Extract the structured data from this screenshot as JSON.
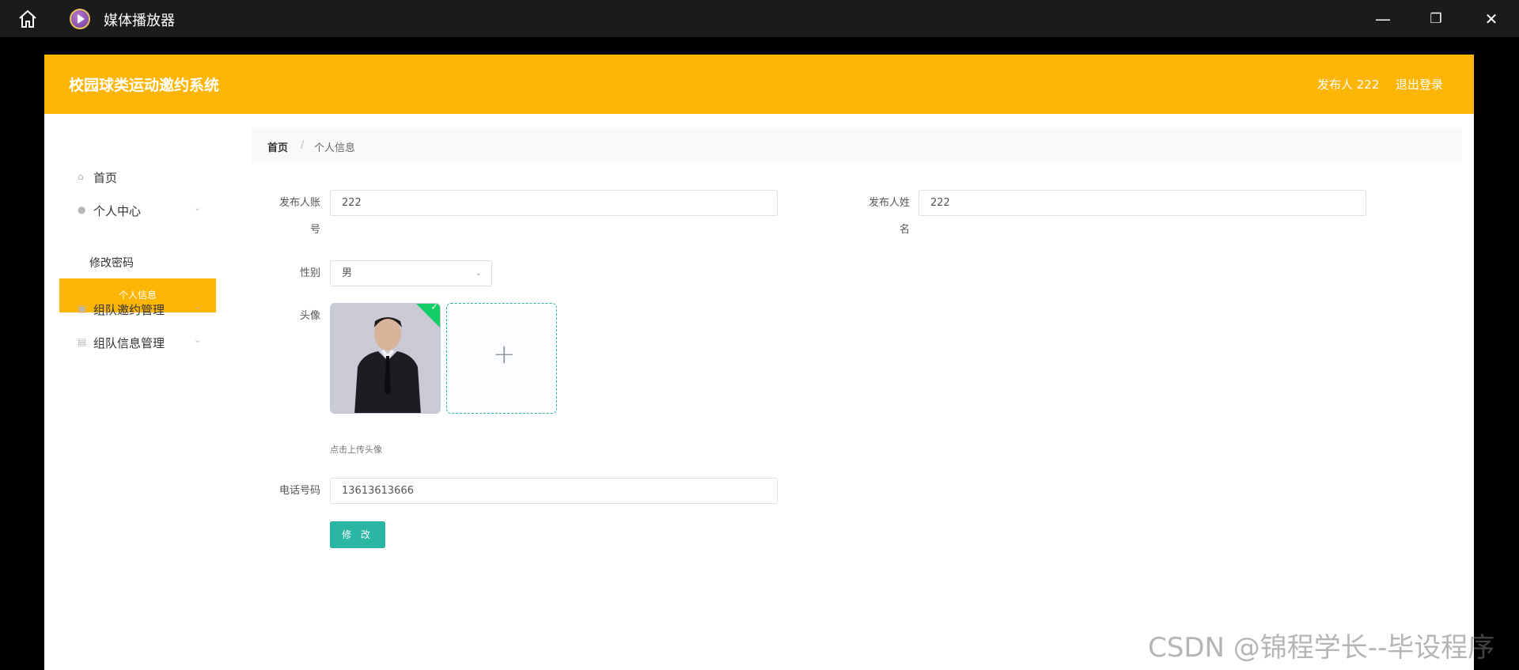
{
  "window": {
    "title": "媒体播放器",
    "home_icon": "home-icon",
    "minimize_glyph": "—",
    "restore_glyph": "❐",
    "close_glyph": "✕"
  },
  "header": {
    "system_title": "校园球类运动邀约系统",
    "user_label": "发布人 222",
    "logout_label": "退出登录",
    "accent_color": "#fdb605"
  },
  "sidebar": {
    "home": "首页",
    "personal_center": "个人中心",
    "change_password": "修改密码",
    "personal_info": "个人信息",
    "team_invite_mgmt": "组队邀约管理",
    "team_info_mgmt": "组队信息管理"
  },
  "breadcrumb": {
    "root": "首页",
    "separator": "/",
    "current": "个人信息"
  },
  "form": {
    "account_label_1": "发布人账",
    "account_label_2": "号",
    "account_value": "222",
    "name_label_1": "发布人姓",
    "name_label_2": "名",
    "name_value": "222",
    "gender_label": "性别",
    "gender_value": "男",
    "avatar_label": "头像",
    "upload_tip": "点击上传头像",
    "phone_label": "电话号码",
    "phone_value": "13613613666",
    "save_label": "修 改",
    "button_color": "#2bb5a3"
  },
  "watermark": "CSDN @锦程学长--毕设程序"
}
